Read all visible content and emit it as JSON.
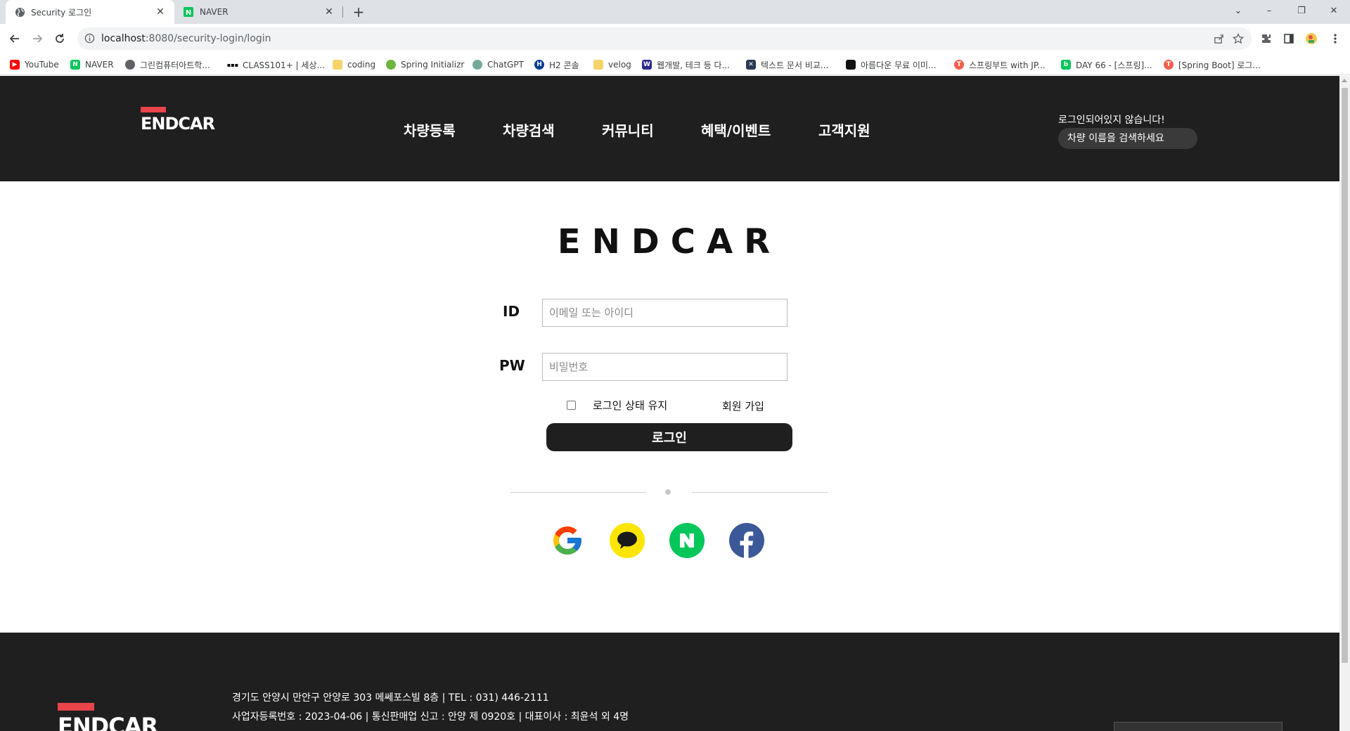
{
  "browser": {
    "tabs": [
      {
        "title": "Security 로그인",
        "active": true,
        "favicon": "globe-icon"
      },
      {
        "title": "NAVER",
        "active": false,
        "favicon": "naver-icon"
      }
    ],
    "new_tab_label": "+",
    "window_controls": {
      "minimize": "–",
      "restore": "❐",
      "close": "✕",
      "dropdown": "⌄"
    },
    "url_host": "localhost",
    "url_path": ":8080/security-login/login",
    "bookmarks": [
      {
        "label": "YouTube",
        "icon": "youtube-icon",
        "color": "#ff0000"
      },
      {
        "label": "NAVER",
        "icon": "naver-icon",
        "color": "#03c75a"
      },
      {
        "label": "그린컴퓨터아트학...",
        "icon": "globe-icon",
        "color": "#5f6368"
      },
      {
        "label": "CLASS101+ | 세상...",
        "icon": "class101-icon",
        "color": "#000000"
      },
      {
        "label": "coding",
        "icon": "folder-icon",
        "color": "#f6d46b"
      },
      {
        "label": "Spring Initializr",
        "icon": "spring-icon",
        "color": "#6db33f"
      },
      {
        "label": "ChatGPT",
        "icon": "chatgpt-icon",
        "color": "#74aa9c"
      },
      {
        "label": "H2 콘솔",
        "icon": "h2-icon",
        "color": "#0a3d8f"
      },
      {
        "label": "velog",
        "icon": "folder-icon",
        "color": "#f6d46b"
      },
      {
        "label": "웹개발, 테크 등 다...",
        "icon": "wf-icon",
        "color": "#2c2a8f"
      },
      {
        "label": "텍스트 문서 비교...",
        "icon": "diff-icon",
        "color": "#2b3a55"
      },
      {
        "label": "아름다운 무료 이미...",
        "icon": "unsplash-icon",
        "color": "#111111"
      },
      {
        "label": "스프링부트 with JP...",
        "icon": "tistory-icon",
        "color": "#f25e4d"
      },
      {
        "label": "DAY 66 - [스프링]...",
        "icon": "naver-blog-icon",
        "color": "#03c75a"
      },
      {
        "label": "[Spring Boot] 로그...",
        "icon": "tistory-icon",
        "color": "#f25e4d"
      }
    ]
  },
  "header": {
    "logo_text": "ENDCAR",
    "nav": [
      "차량등록",
      "차량검색",
      "커뮤니티",
      "혜택/이벤트",
      "고객지원"
    ],
    "login_status": "로그인되어있지 않습니다!",
    "search_placeholder": "차량 이름을 검색하세요"
  },
  "login": {
    "title": "ENDCAR",
    "id_label": "ID",
    "id_placeholder": "이메일 또는 아이디",
    "pw_label": "PW",
    "pw_placeholder": "비밀번호",
    "remember_label": "로그인 상태 유지",
    "signup_label": "회원 가입",
    "submit_label": "로그인",
    "social": [
      {
        "name": "google",
        "color": "#ffffff"
      },
      {
        "name": "kakao",
        "color": "#fee500"
      },
      {
        "name": "naver",
        "color": "#03c75a"
      },
      {
        "name": "facebook",
        "color": "#3b5998"
      }
    ]
  },
  "footer": {
    "logo_text": "ENDCAR",
    "address": "경기도 안양시 만안구 안양로 303 메쎄포스빌 8층 | TEL : 031) 446-2111",
    "business": "사업자등록번호 : 2023-04-06 | 통신판매업 신고 : 안양 제 0920호 | 대표이사 : 최윤석 외 4명"
  },
  "colors": {
    "header_bg": "#1f1f1f",
    "accent_red": "#e8444a",
    "button_bg": "#1f1f1f"
  }
}
